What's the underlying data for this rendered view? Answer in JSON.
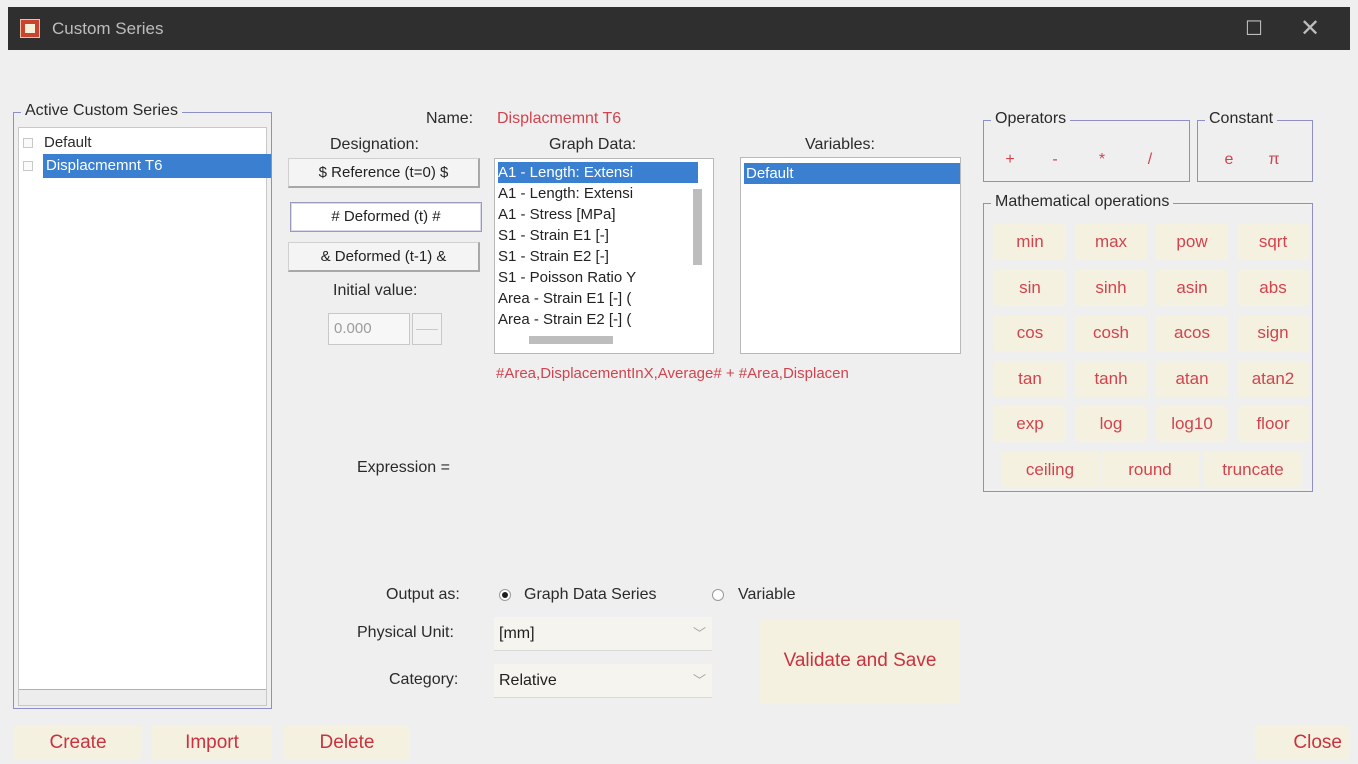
{
  "window": {
    "title": "Custom Series",
    "maximize_glyph": "☐",
    "close_glyph": "✕"
  },
  "active_series": {
    "title": "Active Custom Series",
    "items": [
      {
        "label": "Default",
        "checked": true,
        "selected": false
      },
      {
        "label": "Displacmemnt T6",
        "checked": false,
        "selected": true
      }
    ]
  },
  "name": {
    "label": "Name:",
    "value": "Displacmemnt T6"
  },
  "designation": {
    "label": "Designation:",
    "buttons": [
      "$ Reference (t=0) $",
      "# Deformed  (t)   #",
      "& Deformed  (t-1) &"
    ]
  },
  "initial_value": {
    "label": "Initial value:",
    "value": "0.000"
  },
  "graph_data": {
    "label": "Graph Data:",
    "items": [
      "A1 - Length: Extensi",
      "A1 - Length: Extensi",
      "A1 - Stress [MPa]",
      "S1 - Strain E1 [-]",
      "S1 - Strain E2 [-]",
      "S1 - Poisson Ratio Y",
      "Area - Strain E1 [-] (",
      "Area - Strain E2 [-] ("
    ],
    "selected_index": 0
  },
  "variables": {
    "label": "Variables:",
    "items": [
      "Default"
    ]
  },
  "expression": {
    "preview": "#Area,DisplacementInX,Average# + #Area,Displacen",
    "label": "Expression ="
  },
  "operators": {
    "title": "Operators",
    "items": [
      "+",
      "-",
      "*",
      "/"
    ]
  },
  "constant": {
    "title": "Constant",
    "items": [
      "e",
      "π"
    ]
  },
  "math": {
    "title": "Mathematical operations",
    "rows": [
      [
        "min",
        "max",
        "pow",
        "sqrt"
      ],
      [
        "sin",
        "sinh",
        "asin",
        "abs"
      ],
      [
        "cos",
        "cosh",
        "acos",
        "sign"
      ],
      [
        "tan",
        "tanh",
        "atan",
        "atan2"
      ],
      [
        "exp",
        "log",
        "log10",
        "floor"
      ],
      [
        "ceiling",
        "round",
        "truncate"
      ]
    ]
  },
  "output": {
    "label": "Output as:",
    "options": [
      "Graph Data Series",
      "Variable"
    ],
    "selected": "Graph Data Series"
  },
  "physical_unit": {
    "label": "Physical Unit:",
    "value": "[mm]"
  },
  "category": {
    "label": "Category:",
    "value": "Relative"
  },
  "buttons": {
    "validate": "Validate and Save",
    "create": "Create",
    "import": "Import",
    "delete": "Delete",
    "close": "Close"
  }
}
